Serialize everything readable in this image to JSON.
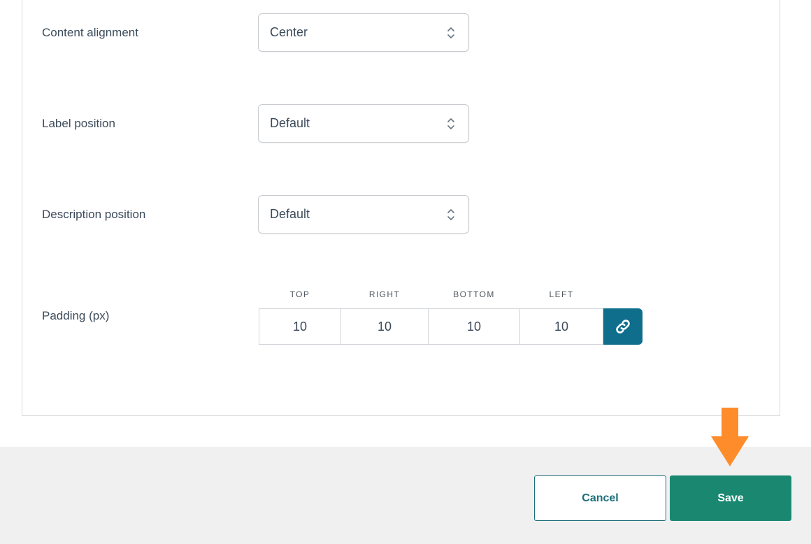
{
  "settings": {
    "content_alignment": {
      "label": "Content alignment",
      "value": "Center"
    },
    "label_position": {
      "label": "Label position",
      "value": "Default"
    },
    "description_position": {
      "label": "Description position",
      "value": "Default"
    }
  },
  "padding": {
    "label": "Padding (px)",
    "headers": {
      "top": "TOP",
      "right": "RIGHT",
      "bottom": "BOTTOM",
      "left": "LEFT"
    },
    "values": {
      "top": "10",
      "right": "10",
      "bottom": "10",
      "left": "10"
    },
    "link_icon": "link-icon"
  },
  "footer": {
    "cancel_label": "Cancel",
    "save_label": "Save"
  },
  "colors": {
    "accent": "#0f6e8c",
    "save": "#1a8871",
    "arrow": "#ff8c2a",
    "footer_bg": "#f0f0f1"
  }
}
